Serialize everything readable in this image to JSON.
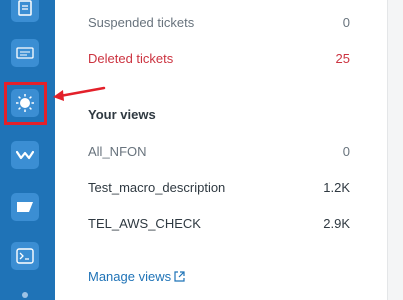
{
  "sidebar": {
    "icons": [
      {
        "name": "knowledge-icon"
      },
      {
        "name": "code-icon"
      },
      {
        "name": "sun-icon"
      },
      {
        "name": "wave-icon"
      },
      {
        "name": "ticket-icon"
      },
      {
        "name": "terminal-icon"
      }
    ]
  },
  "views": {
    "rows": [
      {
        "label": "Suspended tickets",
        "count": "0"
      },
      {
        "label": "Deleted tickets",
        "count": "25"
      }
    ],
    "your_views_title": "Your views",
    "your_views": [
      {
        "label": "All_NFON",
        "count": "0"
      },
      {
        "label": "Test_macro_description",
        "count": "1.2K"
      },
      {
        "label": "TEL_AWS_CHECK",
        "count": "2.9K"
      }
    ],
    "manage_link": "Manage views"
  },
  "colors": {
    "sidebar": "#1f73b7",
    "highlight": "#e3202a",
    "deleted": "#cc3340",
    "link": "#1f73b7"
  }
}
